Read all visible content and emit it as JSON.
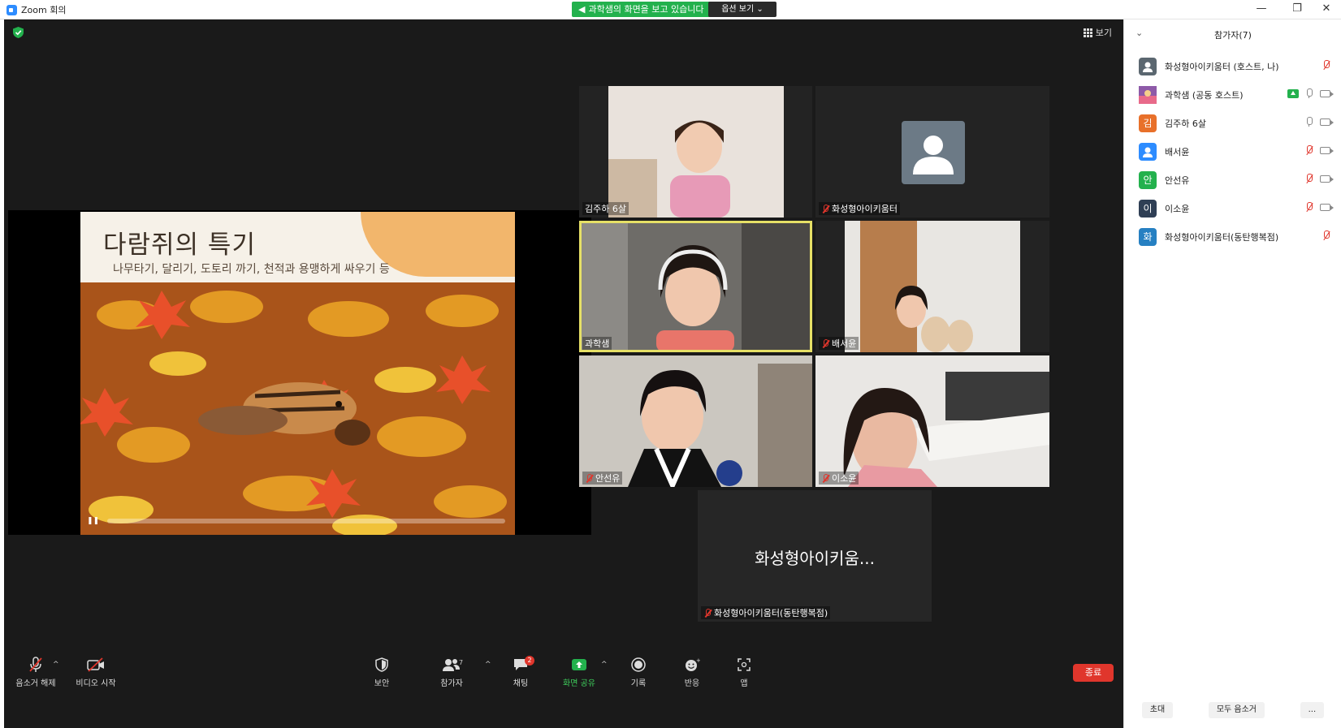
{
  "window": {
    "title": "Zoom 회의",
    "share_banner": "과학샘의 화면을 보고 있습니다",
    "view_options": "옵션 보기 ⌄",
    "minimize": "—",
    "restore": "❐",
    "close": "✕"
  },
  "meeting": {
    "view_label": "보기"
  },
  "shared_screen": {
    "slide_title": "다람쥐의 특기",
    "slide_subtitle": "나무타기, 달리기, 도토리 까기, 천적과 용맹하게 싸우기 등"
  },
  "tiles": [
    {
      "name": "김주하 6살",
      "muted": false
    },
    {
      "name": "화성형아이키움터",
      "muted": true
    },
    {
      "name": "과학샘",
      "muted": false,
      "active": true
    },
    {
      "name": "배서윤",
      "muted": true
    },
    {
      "name": "안선유",
      "muted": true
    },
    {
      "name": "이소윤",
      "muted": true
    },
    {
      "name": "화성형아이키움터(동탄행복점)",
      "muted": true,
      "big_name": "화성형아이키움..."
    }
  ],
  "participants_panel": {
    "title": "참가자(7)",
    "items": [
      {
        "name": "화성형아이키움터 (호스트, 나)",
        "avatar": "",
        "avatar_color": "#5b6770",
        "mic": "off",
        "cam": "none"
      },
      {
        "name": "과학샘 (공동 호스트)",
        "avatar": "",
        "avatar_color": "#7d5ba6",
        "mic": "on",
        "cam": "on",
        "sharing": true
      },
      {
        "name": "김주하 6살",
        "avatar": "김",
        "avatar_color": "#e8702a",
        "mic": "on",
        "cam": "on"
      },
      {
        "name": "배서윤",
        "avatar": "",
        "avatar_color": "#2d8cff",
        "mic": "off",
        "cam": "on"
      },
      {
        "name": "안선유",
        "avatar": "안",
        "avatar_color": "#23b14d",
        "mic": "off",
        "cam": "on"
      },
      {
        "name": "이소윤",
        "avatar": "이",
        "avatar_color": "#2f3f55",
        "mic": "off",
        "cam": "on"
      },
      {
        "name": "화성형아이키움터(동탄행복점)",
        "avatar": "화",
        "avatar_color": "#2680c2",
        "mic": "off",
        "cam": "none"
      }
    ],
    "invite": "초대",
    "mute_all": "모두 음소거",
    "more": "..."
  },
  "toolbar": {
    "unmute": "음소거 해제",
    "start_video": "비디오 시작",
    "security": "보안",
    "participants": "참가자",
    "participants_count": "7",
    "chat": "채팅",
    "chat_badge": "2",
    "share_screen": "화면 공유",
    "record": "기록",
    "reactions": "반응",
    "apps": "앱",
    "end": "종료"
  },
  "colors": {
    "accent_green": "#23b14d",
    "end_red": "#e0362c",
    "active_speaker": "#e6e066"
  }
}
